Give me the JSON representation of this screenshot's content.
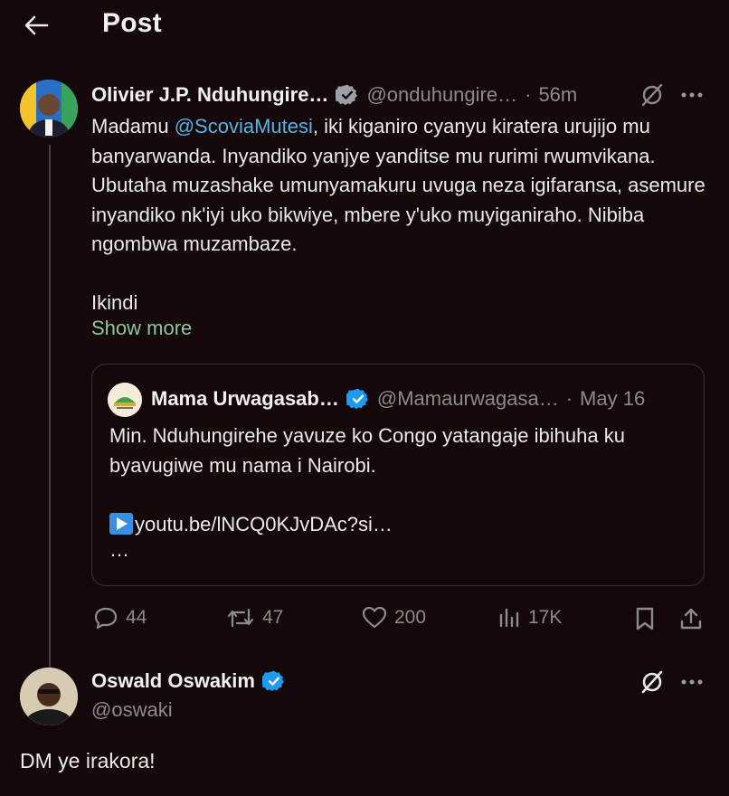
{
  "header": {
    "title": "Post",
    "back_icon": "arrow-left-icon"
  },
  "post": {
    "author_name": "Olivier J.P. Nduhungire…",
    "handle": "@onduhungire…",
    "separator": "·",
    "time": "56m",
    "text_before_mention": "Madamu ",
    "mention": "@ScoviaMutesi",
    "text_after_mention": ", iki kiganiro cyanyu kiratera urujijo mu banyarwanda. Inyandiko yanjye yanditse mu rurimi rwumvikana. Ubutaha muzashake umunyamakuru uvuga neza igifaransa, asemure inyandiko nk'iyi uko bikwiye, mbere y'uko muyiganiraho. Nibiba ngombwa muzambaze.",
    "text_second_paragraph": "Ikindi",
    "show_more": "Show more",
    "quote": {
      "author_name": "Mama Urwagasab…",
      "handle": "@Mamaurwagasa…",
      "separator": "·",
      "date": "May 16",
      "text": "Min. Nduhungirehe yavuze ko Congo yatangaje ibihuha ku byavugiwe mu nama i Nairobi.",
      "link": "youtu.be/lNCQ0KJvDAc?si…",
      "ellipsis": "…"
    },
    "actions": {
      "replies": "44",
      "reposts": "47",
      "likes": "200",
      "views": "17K"
    }
  },
  "reply": {
    "author_name": "Oswald Oswakim",
    "handle": "@oswaki",
    "text": "DM ye irakora!"
  },
  "colors": {
    "background": "#15080a",
    "mention": "#56b4e4",
    "show_more": "#8ec79a",
    "verified_badge": "#1d9bf0",
    "muted": "#8b8b8b"
  }
}
